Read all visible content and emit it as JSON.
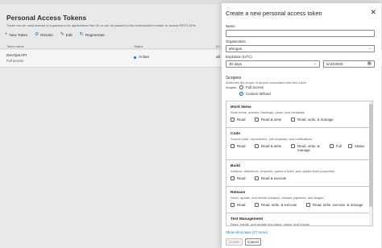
{
  "background": {
    "title": "Personal Access Tokens",
    "description": "These can be used instead of a password for applications like Git or can be passed in the authorization header to access REST APIs",
    "toolbar": [
      {
        "icon": "plus-icon",
        "glyph": "+",
        "label": "New Token"
      },
      {
        "icon": "revoke-icon",
        "glyph": "⊘",
        "label": "Revoke"
      },
      {
        "icon": "edit-icon",
        "glyph": "✎",
        "label": "Edit"
      },
      {
        "icon": "regenerate-icon",
        "glyph": "↻",
        "label": "Regenerate"
      }
    ],
    "columns": [
      "Token name",
      "Status",
      "Ex"
    ],
    "rows": [
      {
        "name": "DevOpsAPI",
        "sub": "Full access",
        "status": "Active",
        "truncated": "all"
      }
    ]
  },
  "panel": {
    "title": "Create a new personal access token",
    "close_glyph": "✕",
    "name_label": "Name",
    "name_value": "",
    "organization_label": "Organization",
    "organization_value": "ahingan",
    "expiration_label": "Expiration (UTC)",
    "expiration_value": "30 days",
    "expiration_date": "5/10/2020",
    "scopes_title": "Scopes",
    "scopes_desc": "Authorize the scope of access associated with this token",
    "scopes_label": "Scopes",
    "scope_modes": [
      {
        "label": "Full access",
        "selected": false
      },
      {
        "label": "Custom defined",
        "selected": true
      }
    ],
    "sections": [
      {
        "title": "Work Items",
        "desc": "Work items, queries, backlogs, plans, and metadata",
        "options": [
          "Read",
          "Read & write",
          "Read, write, & manage"
        ]
      },
      {
        "title": "Code",
        "desc": "Source code, repositories, pull requests, and notifications",
        "options": [
          "Read",
          "Read & write",
          "Read, write, & manage",
          "Full",
          "Status"
        ]
      },
      {
        "title": "Build",
        "desc": "Artifacts, definitions, requests, queue a build, and update build properties",
        "options": [
          "Read",
          "Read & execute"
        ]
      },
      {
        "title": "Release",
        "desc": "Read, update, and delete releases, release pipelines, and stages",
        "options": [
          "Read",
          "Read, write, & execute",
          "Read, write, execute, & manage"
        ]
      },
      {
        "title": "Test Management",
        "desc": "Read, create, and update test plans, cases, and results",
        "options": []
      }
    ],
    "show_all": "Show all scopes (27 more)",
    "create_label": "Create",
    "cancel_label": "Cancel"
  },
  "colors": {
    "accent": "#0078d4",
    "border": "#c8c6c4"
  }
}
